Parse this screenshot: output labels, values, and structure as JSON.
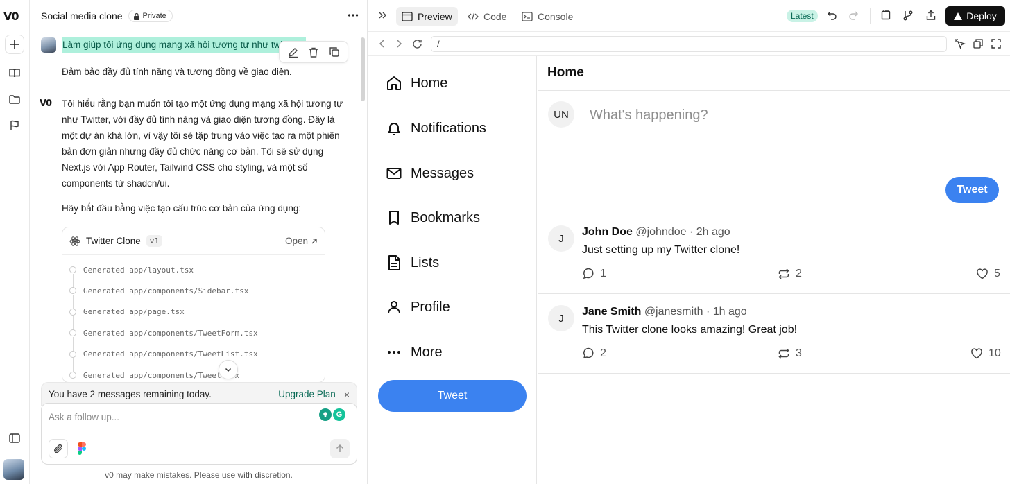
{
  "rail": {
    "logo": "V0"
  },
  "chat": {
    "title": "Social media clone",
    "privacy": "Private",
    "user_message_1": "Làm giúp tôi ứng dụng mạng xã hội tương tự như twitter",
    "user_message_2": "Đảm bảo đầy đủ tính năng và tương đồng về giao diện.",
    "assistant_para_1": "Tôi hiểu rằng bạn muốn tôi tạo một ứng dụng mạng xã hội tương tự như Twitter, với đầy đủ tính năng và giao diện tương đồng. Đây là một dự án khá lớn, vì vậy tôi sẽ tập trung vào việc tạo ra một phiên bản đơn giản nhưng đầy đủ chức năng cơ bản. Tôi sẽ sử dụng Next.js với App Router, Tailwind CSS cho styling, và một số components từ shadcn/ui.",
    "assistant_para_2": "Hãy bắt đầu bằng việc tạo cấu trúc cơ bản của ứng dụng:",
    "artifact": {
      "title": "Twitter Clone",
      "version": "v1",
      "open_label": "Open",
      "files": [
        "Generated app/layout.tsx",
        "Generated app/components/Sidebar.tsx",
        "Generated app/page.tsx",
        "Generated app/components/TweetForm.tsx",
        "Generated app/components/TweetList.tsx",
        "Generated app/components/Tweet.tsx"
      ]
    },
    "quota_text": "You have 2 messages remaining today.",
    "upgrade_label": "Upgrade Plan",
    "close_glyph": "×",
    "composer_placeholder": "Ask a follow up...",
    "grammarly_glyph": "G",
    "disclaimer": "v0 may make mistakes. Please use with discretion."
  },
  "toolbar": {
    "tabs": [
      {
        "label": "Preview",
        "active": true
      },
      {
        "label": "Code",
        "active": false
      },
      {
        "label": "Console",
        "active": false
      }
    ],
    "latest_badge": "Latest",
    "deploy_label": "Deploy"
  },
  "address": {
    "url": "/"
  },
  "twitter": {
    "nav": [
      {
        "label": "Home",
        "icon": "home-icon"
      },
      {
        "label": "Notifications",
        "icon": "bell-icon"
      },
      {
        "label": "Messages",
        "icon": "mail-icon"
      },
      {
        "label": "Bookmarks",
        "icon": "bookmark-icon"
      },
      {
        "label": "Lists",
        "icon": "list-icon"
      },
      {
        "label": "Profile",
        "icon": "user-icon"
      },
      {
        "label": "More",
        "icon": "more-icon"
      }
    ],
    "sidebar_tweet_label": "Tweet",
    "page_title": "Home",
    "composer_avatar": "UN",
    "composer_placeholder": "What's happening?",
    "composer_tweet_label": "Tweet",
    "accent": "#3b82f0",
    "posts": [
      {
        "avatar": "J",
        "name": "John Doe",
        "meta": "@johndoe · 2h ago",
        "text": "Just setting up my Twitter clone!",
        "replies": "1",
        "retweets": "2",
        "likes": "5"
      },
      {
        "avatar": "J",
        "name": "Jane Smith",
        "meta": "@janesmith · 1h ago",
        "text": "This Twitter clone looks amazing! Great job!",
        "replies": "2",
        "retweets": "3",
        "likes": "10"
      }
    ]
  }
}
